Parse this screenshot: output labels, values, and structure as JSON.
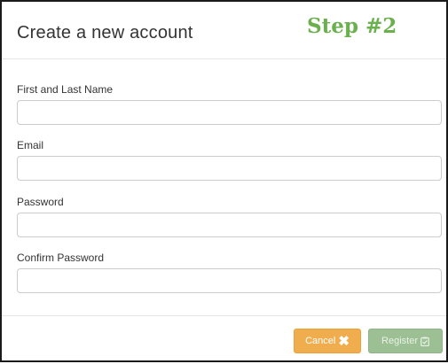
{
  "modal": {
    "title": "Create a new account",
    "step_label": "Step #2"
  },
  "form": {
    "fields": [
      {
        "label": "First and Last Name",
        "value": "",
        "placeholder": ""
      },
      {
        "label": "Email",
        "value": "",
        "placeholder": ""
      },
      {
        "label": "Password",
        "value": "",
        "placeholder": ""
      },
      {
        "label": "Confirm Password",
        "value": "",
        "placeholder": ""
      }
    ]
  },
  "footer": {
    "cancel_label": "Cancel",
    "register_label": "Register"
  },
  "colors": {
    "step_label": "#6ab04c",
    "cancel_button": "#f0ad4e",
    "register_button": "#9cbf94"
  },
  "icons": {
    "cancel": "close-icon",
    "register": "clipboard-check-icon"
  }
}
